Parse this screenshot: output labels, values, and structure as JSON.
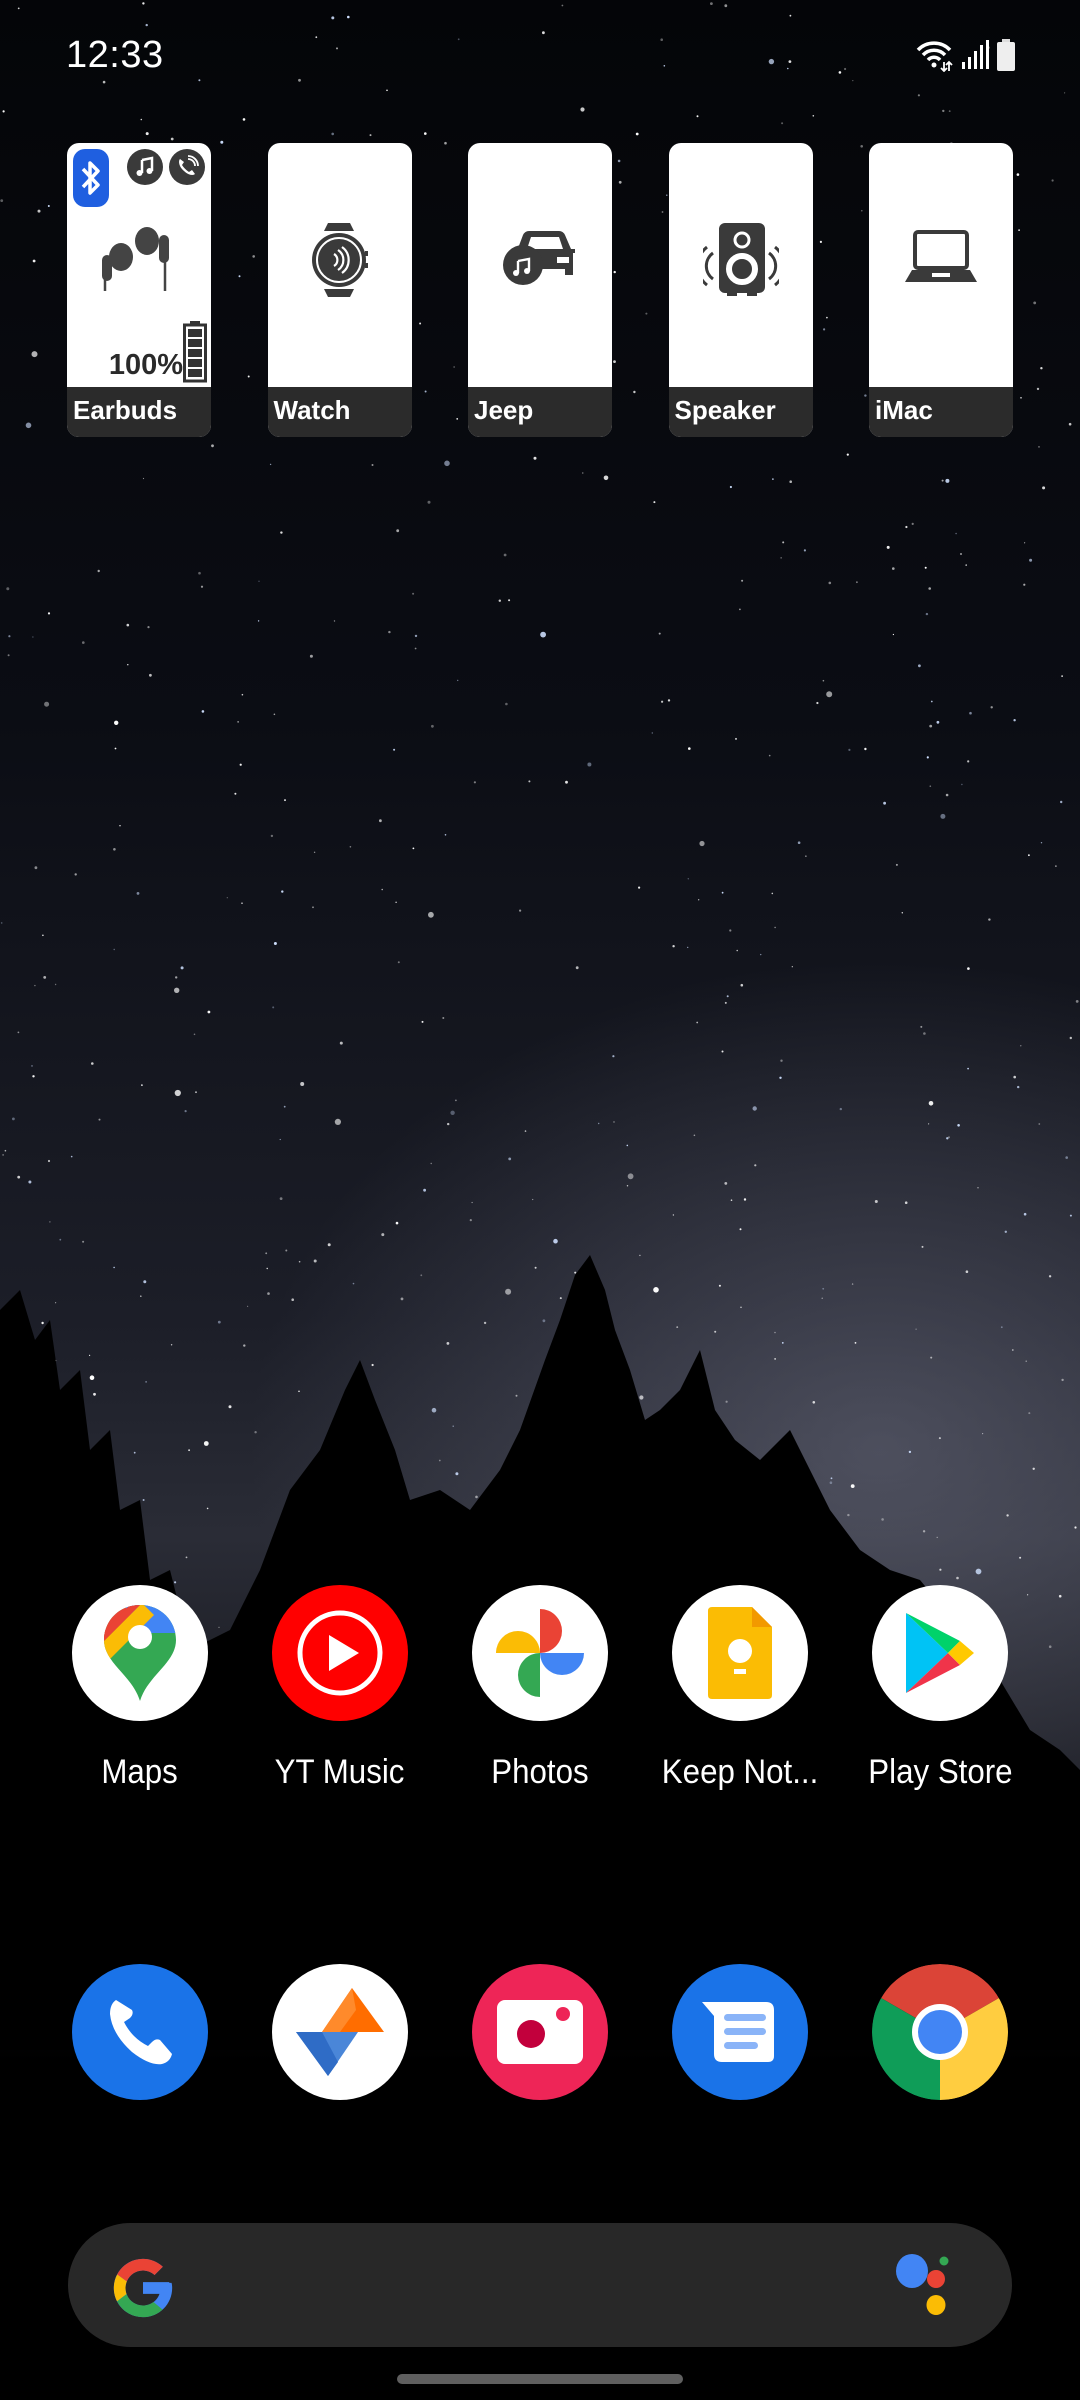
{
  "status_bar": {
    "time": "12:33",
    "icons": [
      "wifi-icon",
      "cellular-signal-icon",
      "battery-icon"
    ]
  },
  "device_widgets": [
    {
      "label": "Earbuds",
      "icon": "earbuds-icon",
      "battery_percent": "100%",
      "badges": [
        "bluetooth-icon",
        "music-note-icon",
        "phone-call-icon"
      ],
      "battery_level": 1.0
    },
    {
      "label": "Watch",
      "icon": "smartwatch-icon"
    },
    {
      "label": "Jeep",
      "icon": "car-audio-icon"
    },
    {
      "label": "Speaker",
      "icon": "speaker-icon"
    },
    {
      "label": "iMac",
      "icon": "laptop-icon"
    }
  ],
  "home_apps": [
    {
      "label": "Maps",
      "icon": "google-maps-icon"
    },
    {
      "label": "YT Music",
      "icon": "youtube-music-icon"
    },
    {
      "label": "Photos",
      "icon": "google-photos-icon"
    },
    {
      "label": "Keep Not...",
      "icon": "google-keep-icon"
    },
    {
      "label": "Play Store",
      "icon": "play-store-icon"
    }
  ],
  "dock_apps": [
    {
      "name": "Phone",
      "icon": "phone-icon"
    },
    {
      "name": "Files",
      "icon": "files-icon"
    },
    {
      "name": "Screen Recorder",
      "icon": "camera-icon"
    },
    {
      "name": "Messages",
      "icon": "messages-icon"
    },
    {
      "name": "Chrome",
      "icon": "chrome-icon"
    }
  ],
  "search_bar": {
    "left_icon": "google-g-icon",
    "right_icon": "google-assistant-icon"
  },
  "colors": {
    "widget_label_bg": "#2b2b2b",
    "bluetooth_blue": "#1f5fe0",
    "search_bar_bg": "#282828",
    "google_blue": "#4285f4",
    "google_red": "#ea4335",
    "google_yellow": "#fbbc05",
    "google_green": "#34a853"
  }
}
